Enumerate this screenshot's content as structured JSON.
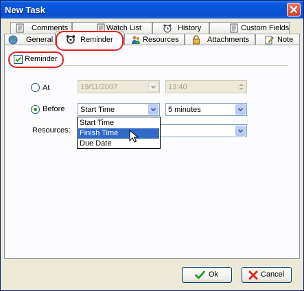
{
  "window": {
    "title": "New Task"
  },
  "tabs_back": [
    {
      "id": "comments",
      "label": "Comments",
      "icon": "notepad-icon"
    },
    {
      "id": "watchlist",
      "label": "Watch List",
      "icon": "notepad-icon"
    },
    {
      "id": "history",
      "label": "History",
      "icon": "clock-icon"
    },
    {
      "id": "customfields",
      "label": "Custom Fields",
      "icon": "notepad-icon"
    }
  ],
  "tabs_front": [
    {
      "id": "general",
      "label": "General",
      "icon": "globe-icon"
    },
    {
      "id": "reminder",
      "label": "Reminder",
      "icon": "alarm-clock-icon",
      "active": true
    },
    {
      "id": "resources",
      "label": "Resources",
      "icon": "resources-icon"
    },
    {
      "id": "attachments",
      "label": "Attachments",
      "icon": "lock-icon"
    },
    {
      "id": "note",
      "label": "Note",
      "icon": "pencil-icon"
    }
  ],
  "reminder": {
    "checkbox_label": "Reminder",
    "checked": true,
    "at_label": "At",
    "at_date": "19/11/2007",
    "at_time": "13:40",
    "before_label": "Before",
    "before_value": "Start Time",
    "before_offset": "5 minutes",
    "resources_label": "Resources:",
    "resources_value": "",
    "dropdown_options": [
      "Start Time",
      "Finish Time",
      "Due Date"
    ],
    "dropdown_hover": "Finish Time"
  },
  "footer": {
    "ok_label": "Ok",
    "cancel_label": "Cancel"
  },
  "colors": {
    "highlight": "#e0211d",
    "accent": "#316ac5",
    "titlebar": "#0654d8"
  }
}
